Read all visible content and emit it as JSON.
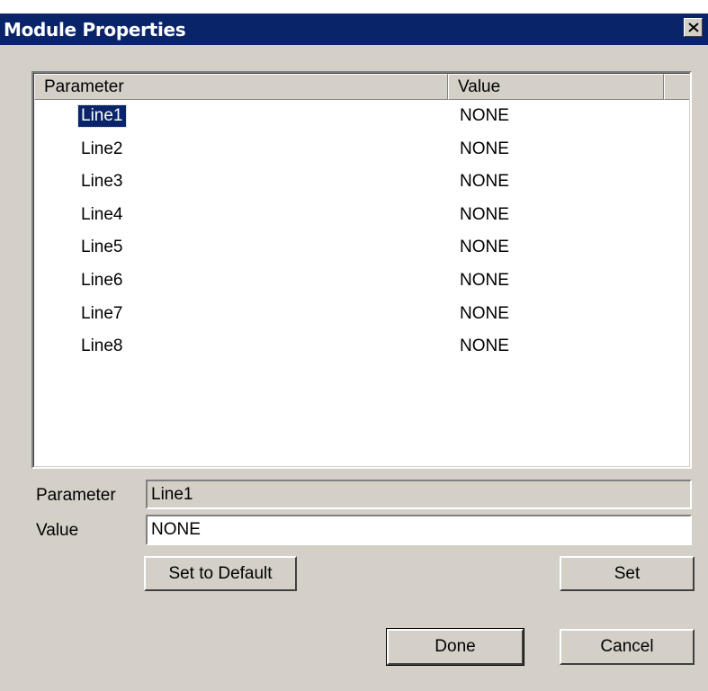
{
  "window": {
    "title": "Module Properties"
  },
  "list": {
    "columns": [
      "Parameter",
      "Value"
    ],
    "rows": [
      {
        "parameter": "Line1",
        "value": "NONE",
        "selected": true
      },
      {
        "parameter": "Line2",
        "value": "NONE"
      },
      {
        "parameter": "Line3",
        "value": "NONE"
      },
      {
        "parameter": "Line4",
        "value": "NONE"
      },
      {
        "parameter": "Line5",
        "value": "NONE"
      },
      {
        "parameter": "Line6",
        "value": "NONE"
      },
      {
        "parameter": "Line7",
        "value": "NONE"
      },
      {
        "parameter": "Line8",
        "value": "NONE"
      }
    ]
  },
  "form": {
    "parameter_label": "Parameter",
    "parameter_value": "Line1",
    "value_label": "Value",
    "value_value": "NONE"
  },
  "buttons": {
    "set_default": "Set to Default",
    "set": "Set",
    "done": "Done",
    "cancel": "Cancel"
  },
  "colors": {
    "titlebar": "#0a246a",
    "face": "#d4d0c8",
    "selection": "#0a246a"
  },
  "icons": {
    "close": "close-x-icon"
  }
}
